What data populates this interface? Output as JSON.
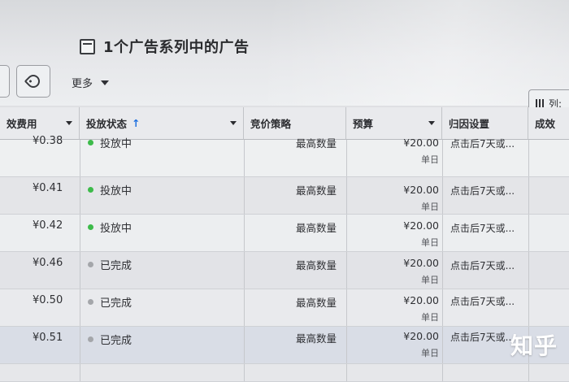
{
  "header": {
    "breadcrumb_title": "1个广告系列中的广告"
  },
  "toolbar": {
    "more_label": "更多",
    "columns_label": "列:"
  },
  "table": {
    "columns": [
      {
        "key": "cost",
        "label": "效费用"
      },
      {
        "key": "status",
        "label": "投放状态",
        "sort_icon": "↑"
      },
      {
        "key": "strategy",
        "label": "竞价策略"
      },
      {
        "key": "budget",
        "label": "预算"
      },
      {
        "key": "attribution",
        "label": "归因设置"
      },
      {
        "key": "results",
        "label": "成效"
      }
    ],
    "rows": [
      {
        "cost": "¥0.38",
        "status": "投放中",
        "status_color": "#3dbb4a",
        "strategy": "最高数量",
        "budget": "¥20.00",
        "budget_period": "单日",
        "attribution": "点击后7天或..."
      },
      {
        "cost": "¥0.41",
        "status": "投放中",
        "status_color": "#3dbb4a",
        "strategy": "最高数量",
        "budget": "¥20.00",
        "budget_period": "单日",
        "attribution": "点击后7天或..."
      },
      {
        "cost": "¥0.42",
        "status": "投放中",
        "status_color": "#3dbb4a",
        "strategy": "最高数量",
        "budget": "¥20.00",
        "budget_period": "单日",
        "attribution": "点击后7天或..."
      },
      {
        "cost": "¥0.46",
        "status": "已完成",
        "status_color": "#a4a6aa",
        "strategy": "最高数量",
        "budget": "¥20.00",
        "budget_period": "单日",
        "attribution": "点击后7天或..."
      },
      {
        "cost": "¥0.50",
        "status": "已完成",
        "status_color": "#a4a6aa",
        "strategy": "最高数量",
        "budget": "¥20.00",
        "budget_period": "单日",
        "attribution": "点击后7天或..."
      },
      {
        "cost": "¥0.51",
        "status": "已完成",
        "status_color": "#a4a6aa",
        "strategy": "最高数量",
        "budget": "¥20.00",
        "budget_period": "单日",
        "attribution": "点击后7天或..."
      }
    ]
  },
  "watermark": "知乎"
}
